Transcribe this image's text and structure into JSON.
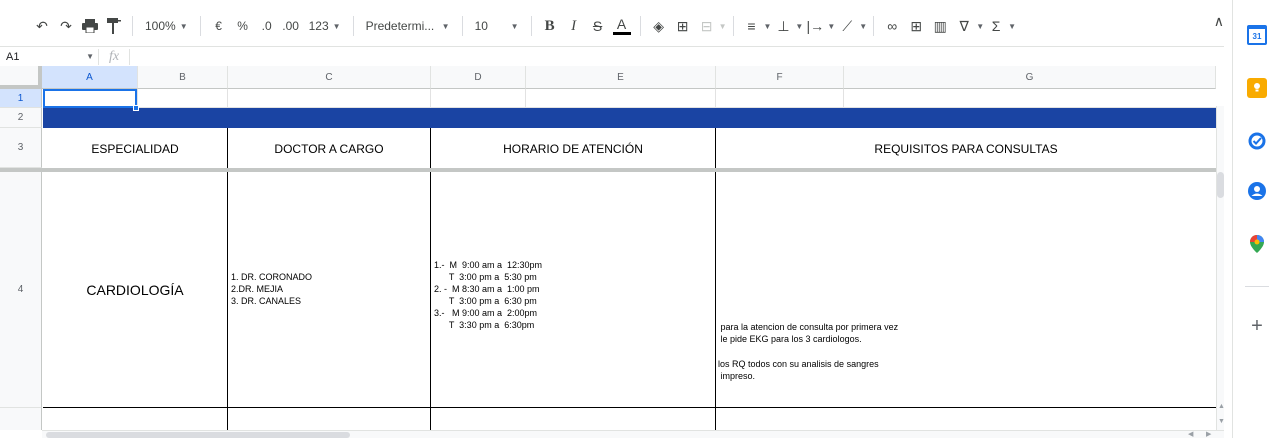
{
  "toolbar": {
    "undo_icon": "undo-icon",
    "redo_icon": "redo-icon",
    "print_icon": "print-icon",
    "paint_format_icon": "paint-format-icon",
    "zoom": "100%",
    "currency": "€",
    "percent": "%",
    "decrease_decimal": ".0",
    "increase_decimal": ".00",
    "more_formats": "123",
    "font_family": "Predetermi...",
    "font_size": "10",
    "bold": "B",
    "italic": "I",
    "strikethrough": "S",
    "text_color": "A",
    "sum_symbol": "Σ"
  },
  "formula_bar": {
    "cell_ref": "A1",
    "fx": "fx"
  },
  "columns": [
    "A",
    "B",
    "C",
    "D",
    "E",
    "F",
    "G"
  ],
  "rows": [
    "1",
    "2",
    "3",
    "4"
  ],
  "header_row": {
    "especialidad": "ESPECIALIDAD",
    "doctor": "DOCTOR A CARGO",
    "horario": "HORARIO DE ATENCIÓN",
    "requisitos": "REQUISITOS PARA CONSULTAS"
  },
  "row4": {
    "especialidad": "CARDIOLOGÍA",
    "doctors": "1. DR. CORONADO\n2.DR. MEJIA\n3. DR. CANALES",
    "horario": "1.-  M  9:00 am a  12:30pm\n      T  3:00 pm a  5:30 pm\n2. -  M 8:30 am a  1:00 pm\n      T  3:00 pm a  6:30 pm\n3.-   M 9:00 am a  2:00pm\n      T  3:30 pm a  6:30pm",
    "requisitos_1": " para la atencion de consulta por primera vez\n le pide EKG para los 3 cardiologos.",
    "requisitos_2": "los RQ todos con su analisis de sangres\n impreso."
  },
  "colors": {
    "header_band": "#1a44a3",
    "selection": "#1a73e8"
  },
  "side_panel": [
    "calendar-icon",
    "keep-icon",
    "tasks-icon",
    "contacts-icon",
    "maps-icon",
    "add-icon"
  ]
}
